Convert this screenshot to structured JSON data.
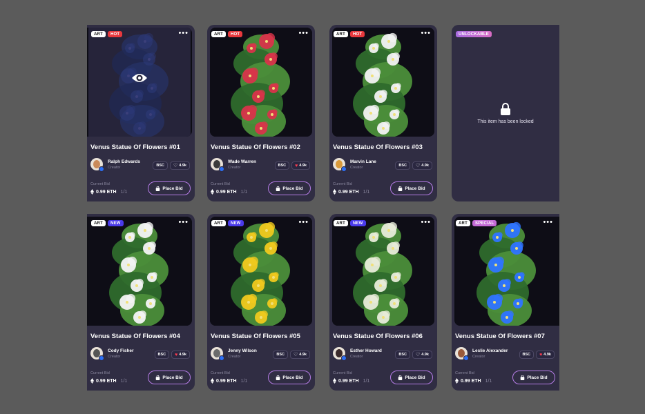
{
  "cards": [
    {
      "title": "Venus Statue Of Flowers #01",
      "tags": [
        "ART",
        "HOT"
      ],
      "creator": "Ralph Edwards",
      "role": "Creator",
      "chain": "BSC",
      "likes": "4.9k",
      "liked": false,
      "bid_label": "Current Bid",
      "price": "0.99 ETH",
      "qty": "1/1",
      "button": "Place Bid",
      "blurred": true
    },
    {
      "title": "Venus Statue Of Flowers #02",
      "tags": [
        "ART",
        "HOT"
      ],
      "creator": "Wade Warren",
      "role": "Creator",
      "chain": "BSC",
      "likes": "4.9k",
      "liked": true,
      "bid_label": "Current Bid",
      "price": "0.99 ETH",
      "qty": "1/1",
      "button": "Place Bid"
    },
    {
      "title": "Venus Statue Of Flowers #03",
      "tags": [
        "ART",
        "HOT"
      ],
      "creator": "Marvin Lane",
      "role": "Creator",
      "chain": "BSC",
      "likes": "4.9k",
      "liked": false,
      "bid_label": "Current Bid",
      "price": "0.99 ETH",
      "qty": "1/1",
      "button": "Place Bid"
    },
    {
      "locked": true,
      "tags": [
        "UNLOCKABLE"
      ],
      "lock_text": "This item has been locked"
    },
    {
      "title": "Venus Statue Of Flowers #04",
      "tags": [
        "ART",
        "NEW"
      ],
      "creator": "Cody Fisher",
      "role": "Creator",
      "chain": "BSC",
      "likes": "4.9k",
      "liked": true,
      "bid_label": "Current Bid",
      "price": "0.99 ETH",
      "qty": "1/1",
      "button": "Place Bid"
    },
    {
      "title": "Venus Statue Of Flowers #05",
      "tags": [
        "ART",
        "NEW"
      ],
      "creator": "Jenny Wilson",
      "role": "Creator",
      "chain": "BSC",
      "likes": "4.9k",
      "liked": false,
      "bid_label": "Current Bid",
      "price": "0.99 ETH",
      "qty": "1/1",
      "button": "Place Bid"
    },
    {
      "title": "Venus Statue Of Flowers #06",
      "tags": [
        "ART",
        "NEW"
      ],
      "creator": "Esther Howard",
      "role": "Creator",
      "chain": "BSC",
      "likes": "4.9k",
      "liked": false,
      "bid_label": "Current Bid",
      "price": "0.99 ETH",
      "qty": "1/1",
      "button": "Place Bid"
    },
    {
      "title": "Venus Statue Of Flowers #07",
      "tags": [
        "ART",
        "SPECIAL"
      ],
      "creator": "Leslie Alexander",
      "role": "Creator",
      "chain": "BSC",
      "likes": "4.9k",
      "liked": true,
      "bid_label": "Current Bid",
      "price": "0.99 ETH",
      "qty": "1/1",
      "button": "Place Bid"
    }
  ],
  "artwork_palettes": [
    "#2d3a7a",
    "#d8344a",
    "#f2f2f2",
    "#e9e6f0",
    "#f4f4f4",
    "#f0c91e",
    "#e8ecd9",
    "#2f74ff"
  ],
  "colors": {
    "background": "#5b5b5b",
    "card": "#302d43",
    "hot": "#e8383d",
    "new": "#4a3aea",
    "accent": "#b77de8",
    "verified": "#2c6ff5"
  }
}
